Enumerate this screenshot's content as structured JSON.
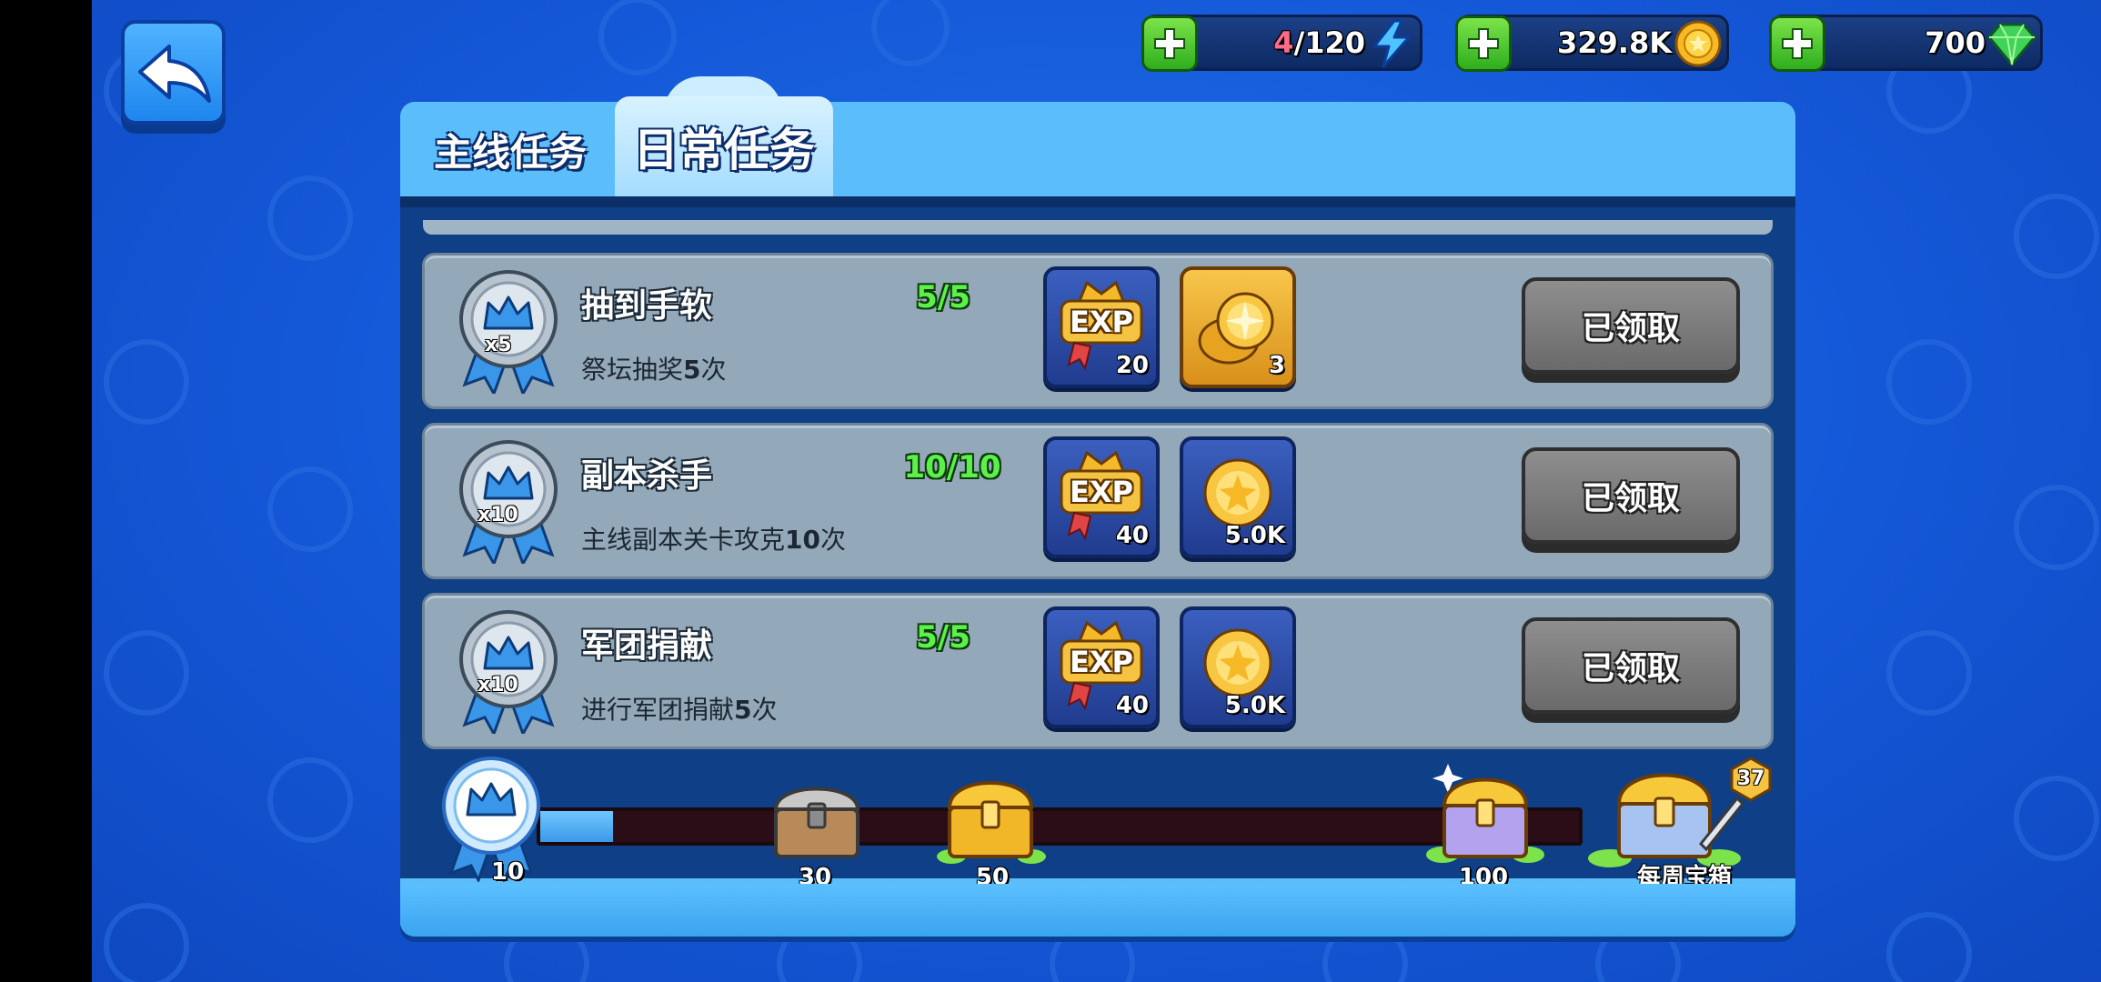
{
  "resources": {
    "energy": {
      "current": "4",
      "max": "/120"
    },
    "coins": "329.8K",
    "gems": "700"
  },
  "tabs": {
    "main": "主线任务",
    "daily": "日常任务"
  },
  "tasks": [
    {
      "title": "抽到手软",
      "progress": "5/5",
      "desc_pre": "祭坛抽奖",
      "desc_num": "5",
      "desc_post": "次",
      "medal": "x5",
      "reward1_qty": "20",
      "reward2_qty": "3",
      "button": "已领取"
    },
    {
      "title": "副本杀手",
      "progress": "10/10",
      "desc_pre": "主线副本关卡攻克",
      "desc_num": "10",
      "desc_post": "次",
      "medal": "x10",
      "reward1_qty": "40",
      "reward2_qty": "5.0K",
      "button": "已领取"
    },
    {
      "title": "军团捐献",
      "progress": "5/5",
      "desc_pre": "进行军团捐献",
      "desc_num": "5",
      "desc_post": "次",
      "medal": "x10",
      "reward1_qty": "40",
      "reward2_qty": "5.0K",
      "button": "已领取"
    }
  ],
  "reward_exp_label": "EXP",
  "milestones": {
    "current_points": "10",
    "progress_fraction": 0.07,
    "labels": [
      "30",
      "50",
      "100"
    ],
    "weekly_label": "每周宝箱",
    "weekly_badge": "37"
  }
}
